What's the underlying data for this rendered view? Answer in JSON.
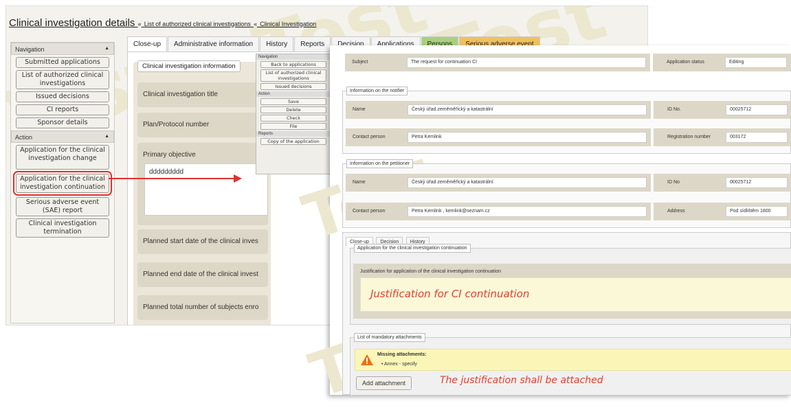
{
  "header": {
    "title": "Clinical investigation details",
    "sep": "«",
    "crumb1": "List of authorized clinical investigations",
    "crumb2": "Clinical Investigation"
  },
  "sidebar": {
    "nav_head": "Navigation",
    "nav_items": [
      "Submitted applications",
      "List of authorized clinical investigations",
      "Issued decisions",
      "CI reports",
      "Sponsor details"
    ],
    "action_head": "Action",
    "action_items": [
      "Application for the clinical investigation change",
      "Application for the clinical investigation continuation",
      "Serious adverse event (SAE) report",
      "Clinical investigation termination"
    ]
  },
  "tabs": [
    "Close-up",
    "Administrative information",
    "History",
    "Reports",
    "Decision",
    "Applications",
    "Persons",
    "Serious adverse event"
  ],
  "main": {
    "section": "Clinical investigation information",
    "fields": {
      "title": "Clinical investigation title",
      "plan": "Plan/Protocol number",
      "objective": "Primary objective",
      "objective_value": "ddddddddd",
      "start": "Planned start date of the clinical inves",
      "end": "Planned end date of the clinical invest",
      "total": "Planned total number of subjects enro"
    }
  },
  "minimenu": {
    "nav_head": "Navigation",
    "nav_items": [
      "Back to applications",
      "List of authorized clinical investigations",
      "Issued decisions"
    ],
    "action_head": "Action",
    "action_items": [
      "Save",
      "Delete",
      "Check",
      "File"
    ],
    "reports_head": "Reports",
    "reports_items": [
      "Copy of the application"
    ]
  },
  "front": {
    "subject_label": "Subject",
    "subject_value": "The request for continuation CI",
    "status_label": "Application status",
    "status_value": "Editing",
    "notifier_legend": "Information on the notifier",
    "notifier": {
      "name_label": "Name",
      "name_value": "Český úřad zeměměřický a katastrální",
      "id_label": "ID No.",
      "id_value": "00025712",
      "contact_label": "Contact person",
      "contact_value": "Petra Kemlink",
      "reg_label": "Registration number",
      "reg_value": "003172"
    },
    "petitioner_legend": "Information on the petitioner",
    "petitioner": {
      "name_label": "Name",
      "name_value": "Český úřad zeměměřický a katastrální",
      "id_label": "ID No",
      "id_value": "00025712",
      "contact_label": "Contact person",
      "contact_value": "Petra Kemlink , kemlink@seznam.cz",
      "address_label": "Address",
      "address_value": "Pod sídlištěm 1800"
    },
    "subtabs": [
      "Close-up",
      "Decision",
      "History"
    ],
    "continuation_legend": "Application for the clinical investigation continuation",
    "justification_label": "Justification for application of the clinical investigation continuation",
    "justification_value": "Justification for CI continuation",
    "attachments_legend": "List of mandatory attachments",
    "missing_title": "Missing attachments:",
    "missing_item": "Annex - specify",
    "add_button": "Add attachment",
    "note": "The justification shall be attached"
  },
  "watermark": "Test",
  "colors": {
    "highlight": "#e03030",
    "annotation": "#e04030",
    "persons_tab": "#a8d080",
    "sae_tab": "#f0c060",
    "justification_bg": "#fbf8d8",
    "warning_bg": "#fbf6b8"
  }
}
